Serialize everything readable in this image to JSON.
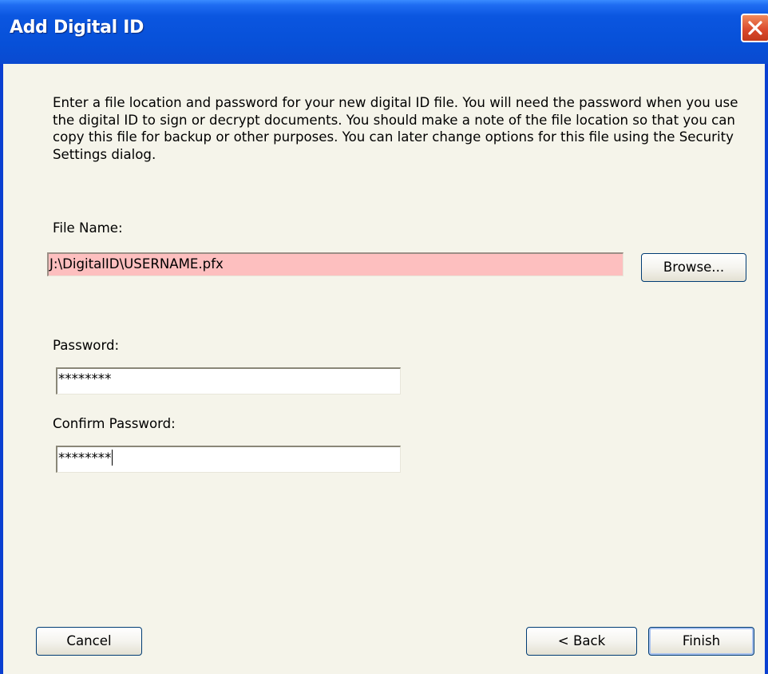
{
  "window": {
    "title": "Add Digital ID",
    "close_icon": "close-icon"
  },
  "instructions": "Enter a file location and password for your new digital ID file. You will need the password when you use the digital ID to sign or decrypt documents. You should make a note of the file location so that you can copy this file for backup or other purposes. You can later change options for this file using the Security Settings dialog.",
  "file_name": {
    "label": "File Name:",
    "value": "J:\\DigitalID\\USERNAME.pfx",
    "browse_label": "Browse..."
  },
  "password": {
    "label": "Password:",
    "value": "********"
  },
  "confirm_password": {
    "label": "Confirm Password:",
    "value": "********"
  },
  "buttons": {
    "cancel": "Cancel",
    "back": "< Back",
    "finish": "Finish"
  },
  "colors": {
    "title_bar": "#0750d8",
    "dialog_background": "#f5f4ea",
    "invalid_field": "#fdbfbf"
  }
}
